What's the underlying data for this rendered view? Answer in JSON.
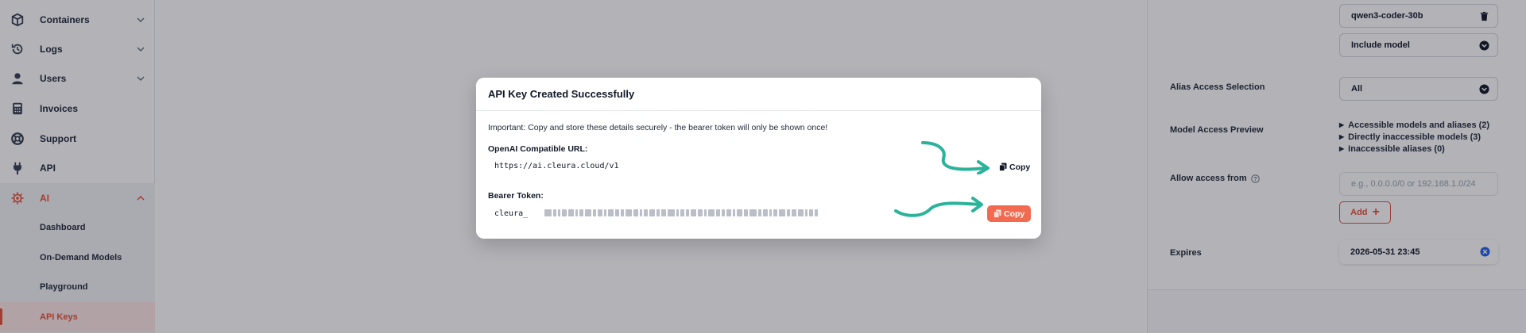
{
  "sidebar": {
    "items": [
      {
        "label": "Containers",
        "icon": "box-icon"
      },
      {
        "label": "Logs",
        "icon": "history-icon"
      },
      {
        "label": "Users",
        "icon": "user-icon"
      },
      {
        "label": "Invoices",
        "icon": "calculator-icon"
      },
      {
        "label": "Support",
        "icon": "lifebuoy-icon"
      },
      {
        "label": "API",
        "icon": "plug-icon"
      },
      {
        "label": "AI",
        "icon": "ai-chip-icon"
      }
    ],
    "ai_subitems": [
      {
        "label": "Dashboard"
      },
      {
        "label": "On-Demand Models"
      },
      {
        "label": "Playground"
      },
      {
        "label": "API Keys"
      }
    ],
    "accent_color": "#e8513a"
  },
  "panel": {
    "model_value": "qwen3-coder-30b",
    "include_model": "Include model",
    "alias_access_label": "Alias Access Selection",
    "alias_access_value": "All",
    "model_preview_label": "Model Access Preview",
    "preview_items": [
      "Accessible models and aliases (2)",
      "Directly inaccessible models (3)",
      "Inaccessible aliases (0)"
    ],
    "allow_access_label": "Allow access from",
    "allow_access_placeholder": "e.g., 0.0.0.0/0 or 192.168.1.0/24",
    "add_label": "Add",
    "expires_label": "Expires",
    "expires_value": "2026-05-31 23:45"
  },
  "modal": {
    "title": "API Key Created Successfully",
    "warning": "Important: Copy and store these details securely - the bearer token will only be shown once!",
    "url_label": "OpenAI Compatible URL:",
    "url_value": "https://ai.cleura.cloud/v1",
    "token_label": "Bearer Token:",
    "token_prefix": "cleura_",
    "copy_label": "Copy",
    "copy_button_color": "#f26b51",
    "arrow_color": "#2bb39a"
  }
}
